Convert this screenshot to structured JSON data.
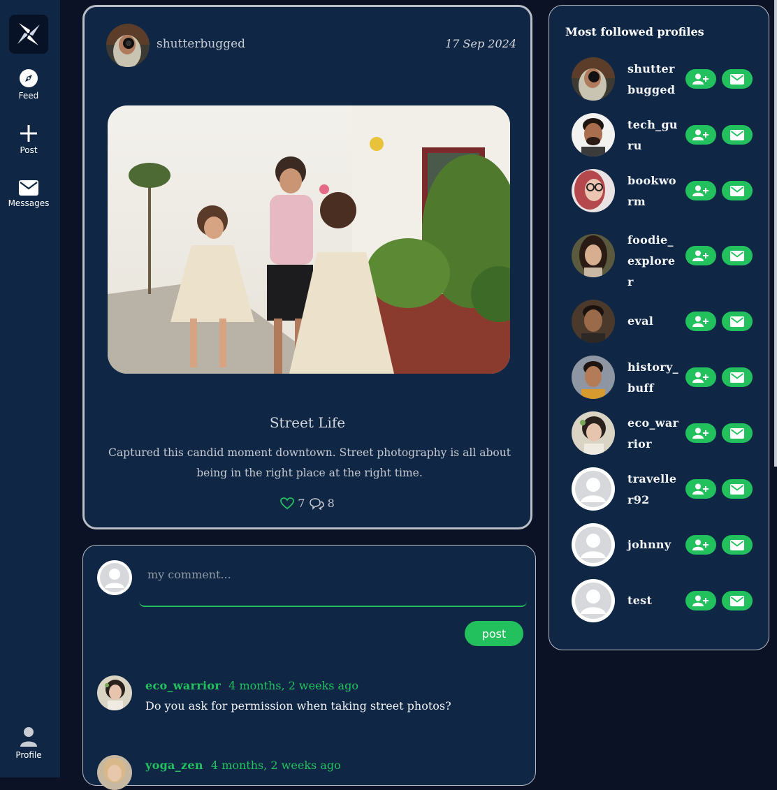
{
  "nav": {
    "items": [
      {
        "label": "Feed",
        "icon": "compass-icon"
      },
      {
        "label": "Post",
        "icon": "plus-icon"
      },
      {
        "label": "Messages",
        "icon": "envelope-icon"
      }
    ],
    "profile_label": "Profile"
  },
  "post": {
    "author": "shutterbugged",
    "date": "17 Sep 2024",
    "title": "Street Life",
    "body": "Captured this candid moment downtown. Street photography is all about being in the right place at the right time.",
    "likes": "7",
    "comments": "8"
  },
  "comment_form": {
    "placeholder": "my comment...",
    "button_label": "post"
  },
  "comments": [
    {
      "user": "eco_warrior",
      "time": "4 months, 2 weeks ago",
      "text": "Do you ask for permission when taking street photos?"
    },
    {
      "user": "yoga_zen",
      "time": "4 months, 2 weeks ago",
      "text": ""
    }
  ],
  "sidebar": {
    "title": "Most followed profiles",
    "profiles": [
      {
        "name": "shutterbugged"
      },
      {
        "name": "tech_guru"
      },
      {
        "name": "bookworm"
      },
      {
        "name": "foodie_explorer"
      },
      {
        "name": "eval"
      },
      {
        "name": "history_buff"
      },
      {
        "name": "eco_warrior"
      },
      {
        "name": "traveller92"
      },
      {
        "name": "johnny"
      },
      {
        "name": "test"
      }
    ]
  },
  "colors": {
    "accent": "#22c15e",
    "panel": "#0f2644",
    "background": "#0b1226"
  }
}
